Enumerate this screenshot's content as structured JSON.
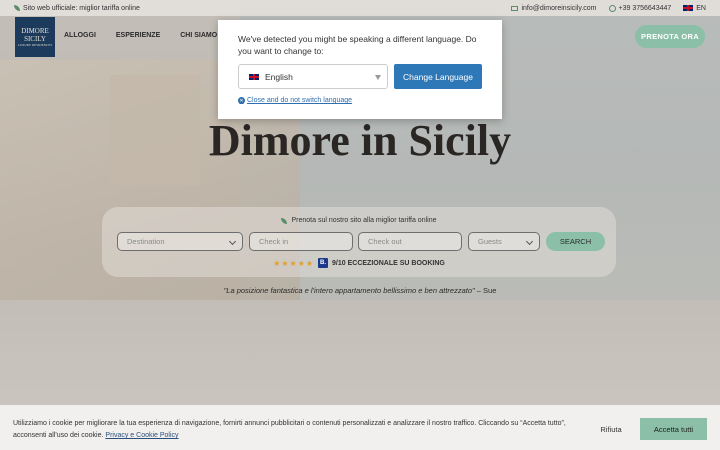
{
  "topbar": {
    "official": "Sito web ufficiale: miglior tariffa online",
    "email": "info@dimoreinsicily.com",
    "phone": "+39 3756643447",
    "language": "EN"
  },
  "logo": {
    "line1": "DIMORE",
    "line2": "SICILY",
    "tagline": "LUXURY RESIDENCES"
  },
  "nav": {
    "items": [
      "ALLOGGI",
      "ESPERIENZE",
      "CHI SIAMO"
    ],
    "book_label": "PRENOTA ORA"
  },
  "hero": {
    "title": "Dimore in Sicily"
  },
  "search": {
    "note": "Prenota sul nostro sito alla miglior tariffa online",
    "destination_placeholder": "Destination",
    "checkin_placeholder": "Check in",
    "checkout_placeholder": "Check out",
    "guests_placeholder": "Guests",
    "button": "SEARCH"
  },
  "rating": {
    "stars": "★★★★★",
    "badge": "B.",
    "text": "9/10 ECCEZIONALE SU BOOKING"
  },
  "quote": {
    "text": "\"La posizione fantastica e l'intero appartamento bellissimo e ben attrezzato\"",
    "author": "– Sue"
  },
  "language_popup": {
    "message": "We've detected you might be speaking a different language. Do you want to change to:",
    "selected": "English",
    "change_button": "Change Language",
    "close_link": "Close and do not switch language"
  },
  "cookie": {
    "text": "Utilizziamo i cookie per migliorare la tua esperienza di navigazione, fornirti annunci pubblicitari o contenuti personalizzati e analizzare il nostro traffico. Cliccando su “Accetta tutto”, acconsenti all'uso dei cookie.",
    "policy_link": "Privacy e Cookie Policy",
    "reject": "Rifiuta",
    "accept": "Accetta tutti"
  },
  "colors": {
    "accent": "#8bbfa8",
    "brand_navy": "#1c3a5b",
    "popup_button": "#2f78b7"
  }
}
